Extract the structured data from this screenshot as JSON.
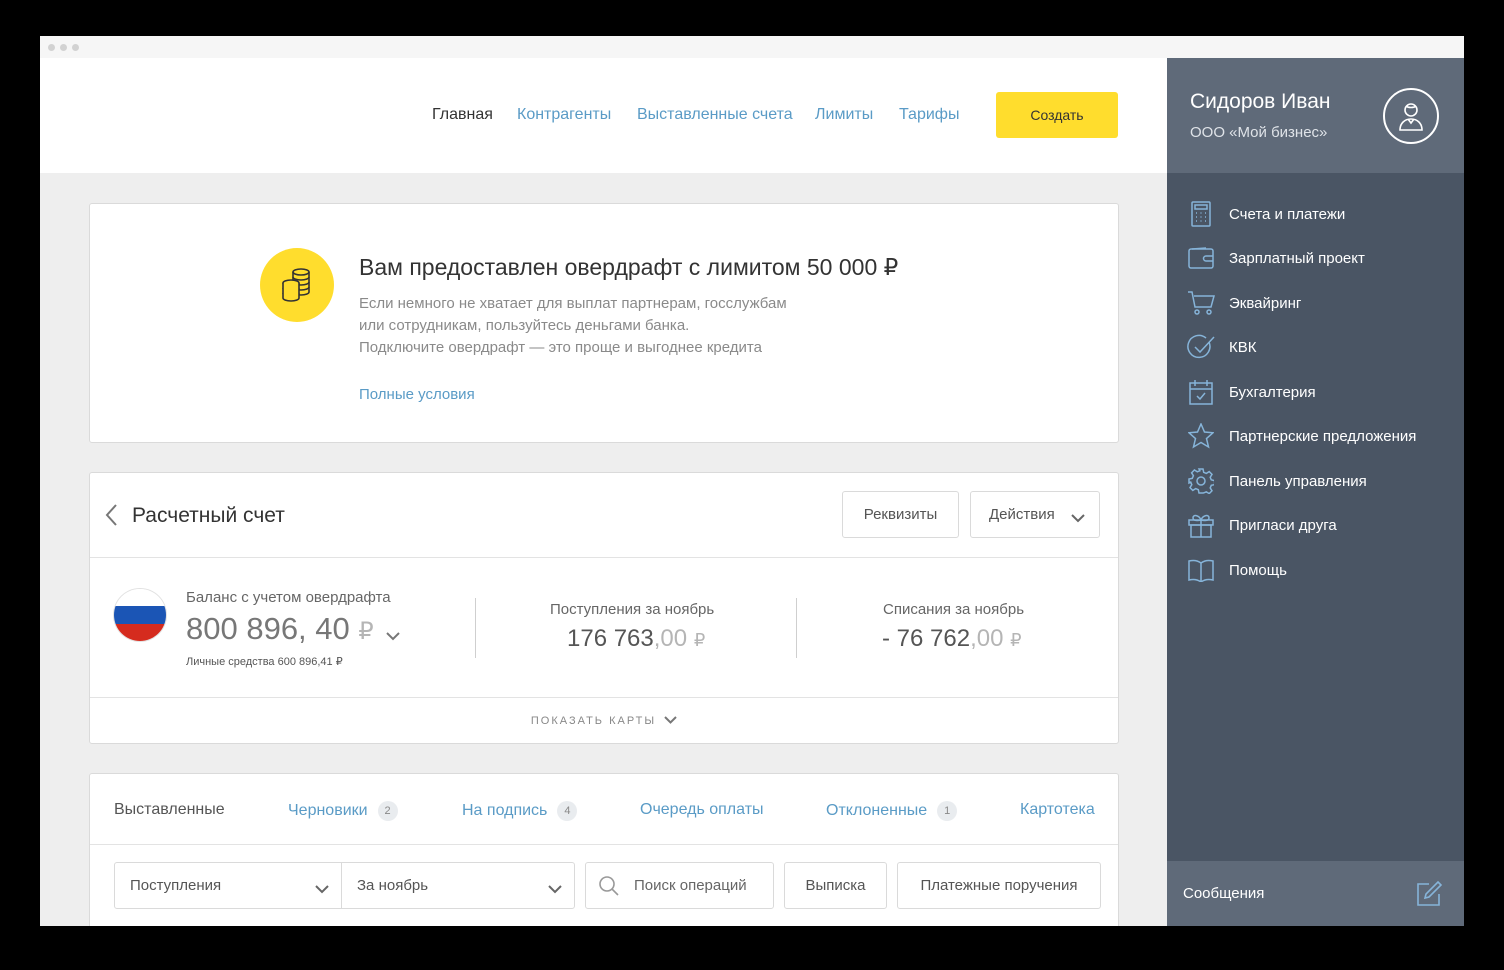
{
  "nav": {
    "items": [
      "Главная",
      "Контрагенты",
      "Выставленные счета",
      "Лимиты",
      "Тарифы"
    ],
    "create_label": "Создать"
  },
  "overdraft": {
    "title": "Вам предоставлен овердрафт с лимитом 50 000 ₽",
    "lines": [
      "Если немного не хватает для выплат партнерам, госслужбам",
      "или сотрудникам, пользуйтесь деньгами банка.",
      "Подключите овердрафт — это проще и выгоднее кредита"
    ],
    "link": "Полные условия",
    "icon": "coins-icon"
  },
  "account": {
    "title": "Расчетный счет",
    "requisites_label": "Реквизиты",
    "actions_label": "Действия",
    "balance_label": "Баланс с учетом овердрафта",
    "balance_value": "800 896, 40",
    "currency": "₽",
    "own_funds": "Личные средства 600 896,41 ₽",
    "income_label": "Поступления за ноябрь",
    "income_value": "176 763",
    "income_cents": ",00",
    "outcome_label": "Списания за ноябрь",
    "outcome_value": "- 76 762",
    "outcome_cents": ",00",
    "show_cards": "ПОКАЗАТЬ КАРТЫ",
    "flag_colors": [
      "#ffffff",
      "#1b55b5",
      "#d52b1e"
    ]
  },
  "payments": {
    "tabs": [
      {
        "label": "Выставленные",
        "badge": ""
      },
      {
        "label": "Черновики",
        "badge": "2"
      },
      {
        "label": "На подпись",
        "badge": "4"
      },
      {
        "label": "Очередь оплаты",
        "badge": ""
      },
      {
        "label": "Отклоненные",
        "badge": "1"
      },
      {
        "label": "Картотека",
        "badge": ""
      }
    ],
    "filter_type": "Поступления",
    "filter_period": "За ноябрь",
    "search_placeholder": "Поиск операций",
    "statement_label": "Выписка",
    "orders_label": "Платежные поручения"
  },
  "sidebar": {
    "user_name": "Сидоров Иван",
    "company": "ООО «Мой бизнес»",
    "menu": [
      {
        "label": "Счета и платежи",
        "icon": "calculator-icon"
      },
      {
        "label": "Зарплатный проект",
        "icon": "wallet-icon"
      },
      {
        "label": "Эквайринг",
        "icon": "cart-icon"
      },
      {
        "label": "КВК",
        "icon": "check-circle-icon"
      },
      {
        "label": "Бухгалтерия",
        "icon": "calendar-icon"
      },
      {
        "label": "Партнерские предложения",
        "icon": "star-icon"
      },
      {
        "label": "Панель управления",
        "icon": "gear-icon"
      },
      {
        "label": "Пригласи друга",
        "icon": "gift-icon"
      },
      {
        "label": "Помощь",
        "icon": "book-icon"
      }
    ],
    "messages_label": "Сообщения"
  },
  "colors": {
    "accent": "#ffdd2d",
    "link": "#5a9bc6",
    "sidebar": "#4a5564",
    "sidebar_header": "#5f6a79"
  }
}
